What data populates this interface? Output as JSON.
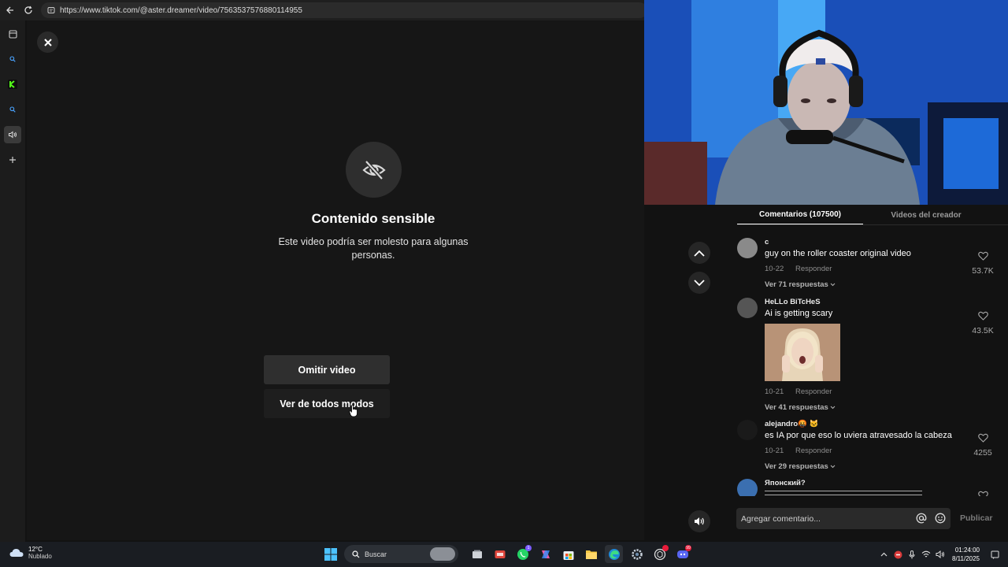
{
  "browser": {
    "url": "https://www.tiktok.com/@aster.dreamer/video/7563537576880114955"
  },
  "sensitive": {
    "title": "Contenido sensible",
    "description": "Este video podría ser molesto para algunas personas.",
    "skip_label": "Omitir video",
    "view_label": "Ver de todos modos"
  },
  "comments_panel": {
    "tabs": [
      {
        "label": "Comentarios (107500)",
        "active": true
      },
      {
        "label": "Videos del creador",
        "active": false
      }
    ],
    "comments": [
      {
        "user": "c",
        "text": "guy on the roller coaster original video",
        "date": "10-22",
        "reply": "Responder",
        "replies": "Ver 71 respuestas",
        "likes": "53.7K"
      },
      {
        "user": "HeLLo BiTcHeS",
        "text": "Ai is getting scary",
        "date": "10-21",
        "reply": "Responder",
        "replies": "Ver 41 respuestas",
        "likes": "43.5K"
      },
      {
        "user": "alejandro🤬 🐱",
        "text": "es IA por que eso lo uviera atravesado la cabeza",
        "date": "10-21",
        "reply": "Responder",
        "replies": "Ver 29 respuestas",
        "likes": "4255"
      },
      {
        "user": "Японский?",
        "text": "",
        "date": "",
        "reply": "",
        "replies": "",
        "likes": ""
      }
    ],
    "input_placeholder": "Agregar comentario...",
    "publish_label": "Publicar"
  },
  "taskbar": {
    "temperature": "12°C",
    "condition": "Nublado",
    "search_label": "Buscar",
    "time": "01:24:00",
    "date": "8/11/2025",
    "whatsapp_badge": "1",
    "discord_badge": "99"
  },
  "colors": {
    "accent": "#fe2c55",
    "panel_bg": "#121212",
    "button_bg": "#2f2f2f"
  }
}
